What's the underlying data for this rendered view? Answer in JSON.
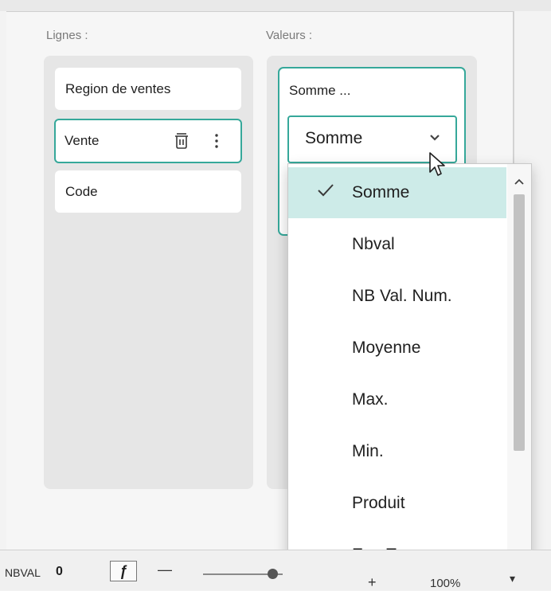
{
  "rows_section": {
    "label": "Lignes :",
    "fields": [
      {
        "name": "Region de ventes"
      },
      {
        "name": "Vente"
      },
      {
        "name": "Code"
      }
    ]
  },
  "values_section": {
    "label": "Valeurs :",
    "card_title": "Somme ...",
    "aggregate_select": {
      "selected": "Somme"
    }
  },
  "aggregate_dropdown": {
    "options": [
      "Somme",
      "Nbval",
      "NB Val. Num.",
      "Moyenne",
      "Max.",
      "Min.",
      "Produit",
      "EcarType"
    ],
    "selected_index": 0
  },
  "status_bar": {
    "formula_name": "NBVAL",
    "formula_value": "0",
    "fx_label": "ƒ",
    "zoom_minus": "—",
    "zoom_plus": "+",
    "zoom_level": "100%"
  },
  "colors": {
    "accent": "#36a89a",
    "selected_bg": "#cdebe8"
  },
  "icons": [
    "trash-icon",
    "more-vertical-icon",
    "chevron-down-icon",
    "checkmark-icon",
    "mouse-cursor-icon",
    "scroll-up-icon",
    "scroll-down-icon",
    "function-icon"
  ]
}
